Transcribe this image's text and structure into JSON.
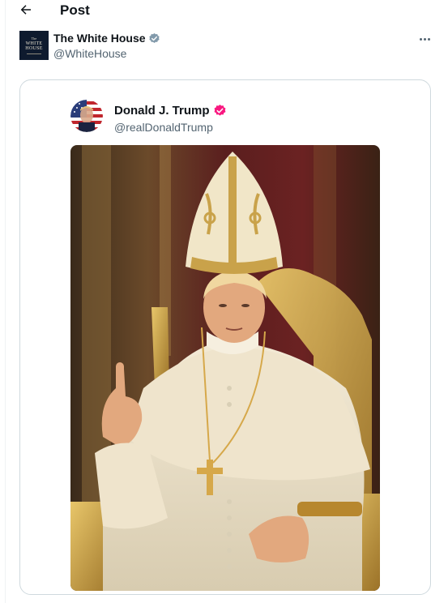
{
  "header": {
    "back_icon": "arrow-left-icon",
    "title": "Post"
  },
  "author": {
    "name": "The White House",
    "handle": "@WhiteHouse",
    "verified_color": "#829aab",
    "avatar_text_top": "The",
    "avatar_text_main": "WHITE HOUSE",
    "more_icon": "more-horizontal-icon"
  },
  "quoted_post": {
    "name": "Donald J. Trump",
    "handle": "@realDonaldTrump",
    "verified_color": "#f91880",
    "image_description_icon": "pope-portrait-image"
  },
  "colors": {
    "text_primary": "#0f1419",
    "text_secondary": "#536471",
    "border": "#cfd9de"
  }
}
